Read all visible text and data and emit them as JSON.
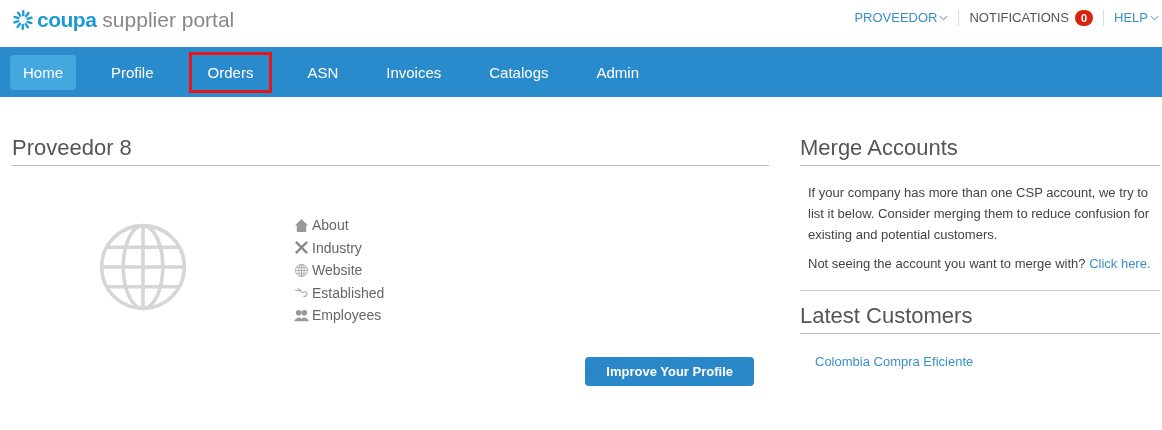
{
  "header": {
    "logo_brand": "coupa",
    "logo_product": "supplier portal",
    "menu": [
      {
        "kind": "dropdown",
        "label": "PROVEEDOR"
      },
      {
        "kind": "notifications",
        "label": "NOTIFICATIONS",
        "count": "0"
      },
      {
        "kind": "dropdown",
        "label": "HELP"
      }
    ]
  },
  "nav": [
    {
      "label": "Home",
      "selected": true,
      "highlighted": false
    },
    {
      "label": "Profile",
      "selected": false,
      "highlighted": false
    },
    {
      "label": "Orders",
      "selected": false,
      "highlighted": true
    },
    {
      "label": "ASN",
      "selected": false,
      "highlighted": false
    },
    {
      "label": "Invoices",
      "selected": false,
      "highlighted": false
    },
    {
      "label": "Catalogs",
      "selected": false,
      "highlighted": false
    },
    {
      "label": "Admin",
      "selected": false,
      "highlighted": false
    }
  ],
  "profile": {
    "title": "Proveedor 8",
    "fields": [
      "About",
      "Industry",
      "Website",
      "Established",
      "Employees"
    ],
    "button": "Improve Your Profile"
  },
  "merge": {
    "title": "Merge Accounts",
    "text": "If your company has more than one CSP account, we try to list it below. Consider merging them to reduce confusion for existing and potential customers.",
    "prompt": "Not seeing the account you want to merge with?",
    "link": "Click here."
  },
  "customers": {
    "title": "Latest Customers",
    "items": [
      "Colombia Compra Eficiente"
    ]
  }
}
